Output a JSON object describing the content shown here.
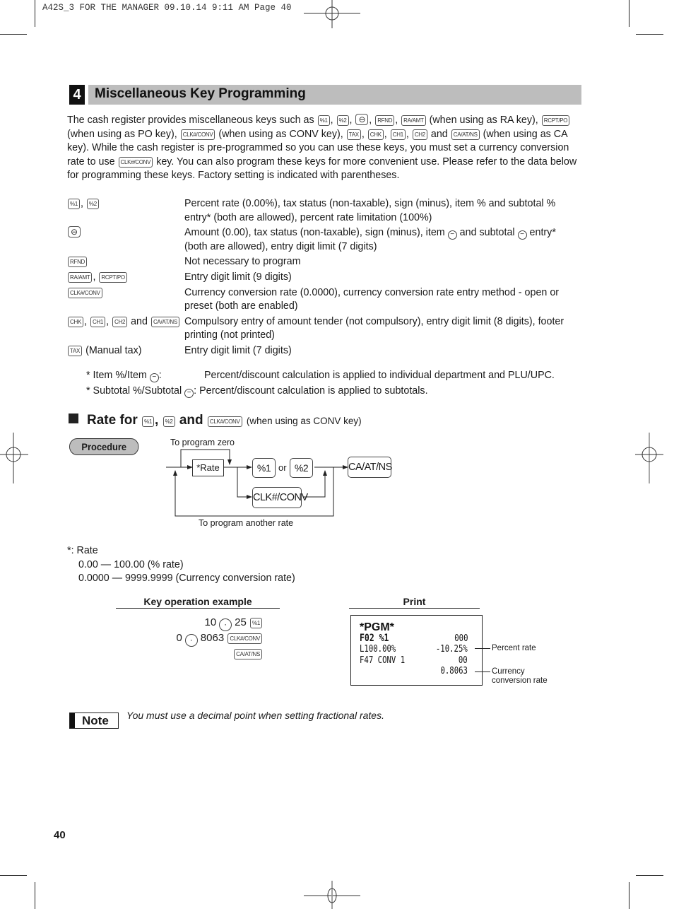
{
  "slug": "A42S_3 FOR THE MANAGER  09.10.14 9:11 AM  Page 40",
  "section": {
    "number": "4",
    "title": "Miscellaneous Key Programming"
  },
  "intro": {
    "p1": "The cash register provides miscellaneous keys such as",
    "k_pct1": "%1",
    "k_pct2": "%2",
    "k_minus": "⊖",
    "k_rfnd": "RFND",
    "k_raamt": "RA/AMT",
    "t_ra": "(when using as RA key),",
    "k_rcptpo": "RCPT/PO",
    "t_po": "(when using as PO key),",
    "k_clkconv": "CLK#/CONV",
    "t_conv": "(when using as CONV key),",
    "k_tax": "TAX",
    "k_chk": "CHK",
    "k_ch1": "CH1",
    "k_ch2": "CH2",
    "t_and": "and",
    "k_caatns": "CA/AT/NS",
    "t_ca": "(when using as CA key).  While the cash register is pre-programmed so you can use these keys, you must set a currency conversion rate to use",
    "t_end": "key.  You can also program these keys for more convenient use.  Please refer to the data below for programming these keys. Factory setting is indicated with parentheses."
  },
  "specs": [
    {
      "desc": "Percent rate (0.00%), tax status (non-taxable), sign (minus), item % and subtotal % entry* (both are allowed), percent rate limitation (100%)"
    },
    {
      "desc_a": "Amount (0.00), tax status (non-taxable), sign (minus), item",
      "desc_b": "and subtotal",
      "desc_c": "entry* (both are allowed), entry digit limit (7 digits)"
    },
    {
      "desc": "Not necessary to program"
    },
    {
      "desc": "Entry digit limit (9 digits)"
    },
    {
      "desc": "Currency conversion rate (0.0000), currency conversion rate entry method - open or preset (both are enabled)"
    },
    {
      "desc": "Compulsory entry of amount tender (not compulsory), entry digit limit (8 digits), footer printing (not printed)"
    },
    {
      "key_note": "(Manual tax)",
      "desc": "Entry digit limit (7 digits)"
    }
  ],
  "footnotes": [
    {
      "label_a": "* Item %/Item",
      "label_b": ":",
      "text": "Percent/discount calculation is applied to individual department and PLU/UPC."
    },
    {
      "label_a": "* Subtotal %/Subtotal",
      "label_b": ":",
      "text": "Percent/discount calculation is applied to subtotals."
    }
  ],
  "subsection": {
    "prefix": "Rate for",
    "comma": ",",
    "and": "and",
    "suffix": "(when using as CONV key)"
  },
  "procedure": {
    "badge": "Procedure",
    "to_zero": "To program zero",
    "rate_box": "*Rate",
    "key1": "%1",
    "or": "or",
    "key2": "%2",
    "key_conv": "CLK#/CONV",
    "key_final": "CA/AT/NS",
    "another": "To program another rate"
  },
  "rate_notes": {
    "head": "*:  Rate",
    "line1": "0.00 — 100.00 (% rate)",
    "line2": "0.0000 — 9999.9999 (Currency conversion rate)"
  },
  "example": {
    "head": "Key operation example",
    "l1_a": "10",
    "l1_dot": "·",
    "l1_b": "25",
    "l1_key": "%1",
    "l2_a": "0",
    "l2_dot": "·",
    "l2_b": "8063",
    "l2_key": "CLK#/CONV",
    "l3_key": "CA/AT/NS"
  },
  "print": {
    "head": "Print",
    "line1": "*PGM*",
    "line2_l": "F02 %1",
    "line2_r": "000",
    "line3_l": "L100.00%",
    "line3_r": "-10.25%",
    "line4_l": "F47 CONV 1",
    "line4_r": "00",
    "line5_r": "0.8063",
    "callout1": "Percent rate",
    "callout2": "Currency conversion rate"
  },
  "note": {
    "badge": "Note",
    "text": "You must use a decimal point when setting fractional rates."
  },
  "page_number": "40"
}
